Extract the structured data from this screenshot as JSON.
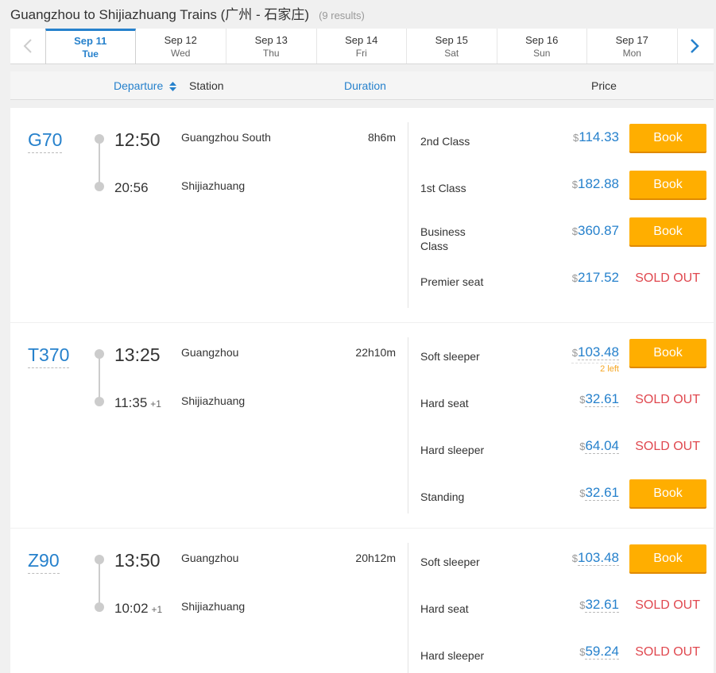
{
  "header": {
    "title": "Guangzhou to Shijiazhuang Trains (广州 - 石家庄)",
    "count": "(9 results)"
  },
  "dates": [
    {
      "date": "Sep 11",
      "weekday": "Tue"
    },
    {
      "date": "Sep 12",
      "weekday": "Wed"
    },
    {
      "date": "Sep 13",
      "weekday": "Thu"
    },
    {
      "date": "Sep 14",
      "weekday": "Fri"
    },
    {
      "date": "Sep 15",
      "weekday": "Sat"
    },
    {
      "date": "Sep 16",
      "weekday": "Sun"
    },
    {
      "date": "Sep 17",
      "weekday": "Mon"
    }
  ],
  "columns": {
    "departure": "Departure",
    "station": "Station",
    "duration": "Duration",
    "price": "Price"
  },
  "book_label": "Book",
  "sold_label": "SOLD OUT",
  "currency": "$",
  "trains": [
    {
      "number": "G70",
      "dep_time": "12:50",
      "arr_time": "20:56",
      "arr_plus": "",
      "dep_station": "Guangzhou South",
      "arr_station": "Shijiazhuang",
      "duration": "8h6m",
      "seats": [
        {
          "class": "2nd Class",
          "price": "114.33",
          "status": "book"
        },
        {
          "class": "1st Class",
          "price": "182.88",
          "status": "book"
        },
        {
          "class": "Business Class",
          "price": "360.87",
          "status": "book"
        },
        {
          "class": "Premier seat",
          "price": "217.52",
          "status": "sold"
        }
      ]
    },
    {
      "number": "T370",
      "dep_time": "13:25",
      "arr_time": "11:35",
      "arr_plus": "+1",
      "dep_station": "Guangzhou",
      "arr_station": "Shijiazhuang",
      "duration": "22h10m",
      "seats": [
        {
          "class": "Soft sleeper",
          "price": "103.48",
          "status": "book",
          "note": "2 left"
        },
        {
          "class": "Hard seat",
          "price": "32.61",
          "status": "sold"
        },
        {
          "class": "Hard sleeper",
          "price": "64.04",
          "status": "sold"
        },
        {
          "class": "Standing",
          "price": "32.61",
          "status": "book"
        }
      ]
    },
    {
      "number": "Z90",
      "dep_time": "13:50",
      "arr_time": "10:02",
      "arr_plus": "+1",
      "dep_station": "Guangzhou",
      "arr_station": "Shijiazhuang",
      "duration": "20h12m",
      "seats": [
        {
          "class": "Soft sleeper",
          "price": "103.48",
          "status": "book"
        },
        {
          "class": "Hard seat",
          "price": "32.61",
          "status": "sold"
        },
        {
          "class": "Hard sleeper",
          "price": "59.24",
          "status": "sold"
        }
      ]
    }
  ],
  "colors": {
    "accent": "#2681cc",
    "book": "#ffae00",
    "sold": "#e0484f"
  }
}
